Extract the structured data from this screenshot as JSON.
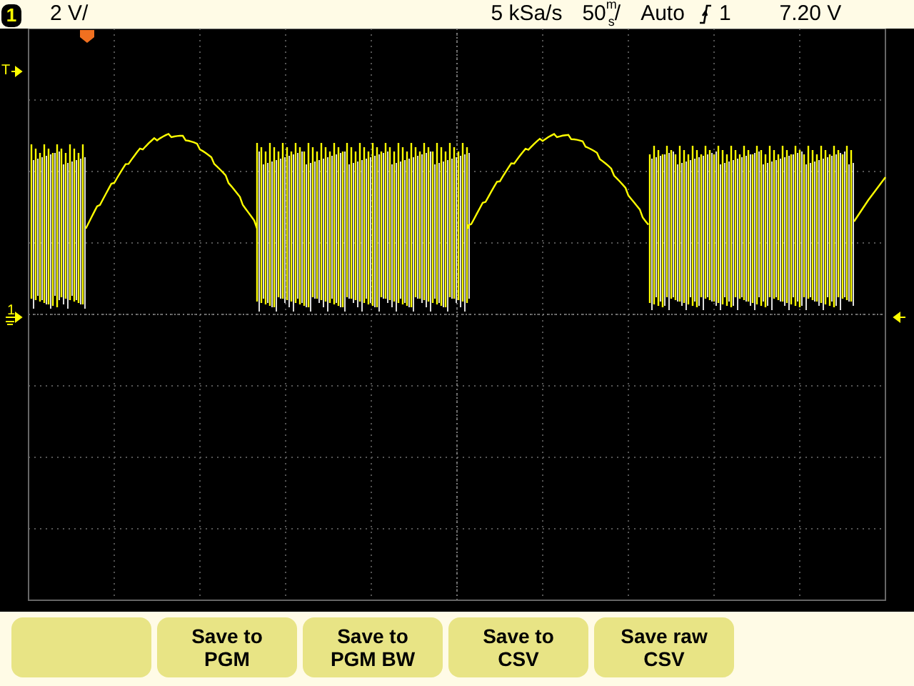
{
  "status_bar": {
    "channel": "1",
    "scale": "2 V/",
    "sample_rate": "5 kSa/s",
    "timebase": "50$^{m}$$_{s}$/",
    "trigger_mode": "Auto",
    "trigger_source": "1",
    "trigger_level": "7.20 V"
  },
  "display": {
    "trigger_level_marker": "T",
    "ground_marker": "1"
  },
  "softkeys": [
    {
      "kind": "blank"
    },
    {
      "kind": "labeled",
      "lines": [
        "Save to",
        "PGM"
      ]
    },
    {
      "kind": "labeled",
      "lines": [
        "Save to",
        "PGM BW"
      ]
    },
    {
      "kind": "labeled",
      "lines": [
        "Save to",
        "CSV"
      ]
    },
    {
      "kind": "labeled",
      "lines": [
        "Save raw",
        "CSV"
      ]
    }
  ]
}
